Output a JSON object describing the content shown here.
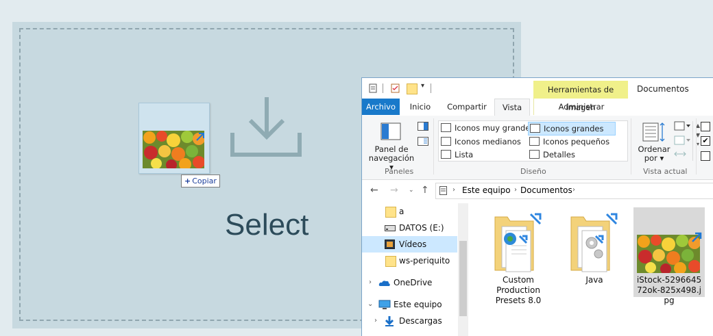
{
  "dropzone": {
    "text": "Select"
  },
  "drag": {
    "tooltip": "Copiar"
  },
  "explorer": {
    "window_title": "Documentos",
    "contextual_tab": "Herramientas de imagen",
    "tabs": [
      "Archivo",
      "Inicio",
      "Compartir",
      "Vista",
      "Administrar"
    ],
    "ribbon": {
      "panes_button": "Panel de navegación",
      "panes_group": "Paneles",
      "layouts": [
        "Iconos muy grandes",
        "Iconos grandes",
        "Iconos medianos",
        "Iconos pequeños",
        "Lista",
        "Detalles"
      ],
      "layouts_selected": "Iconos grandes",
      "layout_group": "Diseño",
      "sort_button": "Ordenar por",
      "current_view_group": "Vista actual"
    },
    "address": {
      "crumbs": [
        "Este equipo",
        "Documentos"
      ]
    },
    "nav_items": [
      {
        "label": "a",
        "icon": "folder-icon"
      },
      {
        "label": "DATOS (E:)",
        "icon": "drive-icon"
      },
      {
        "label": "Vídeos",
        "icon": "videos-icon",
        "selected": true
      },
      {
        "label": "ws-periquito",
        "icon": "folder-icon"
      },
      {
        "label": "OneDrive",
        "icon": "onedrive-icon"
      },
      {
        "label": "Este equipo",
        "icon": "computer-icon"
      },
      {
        "label": "Descargas",
        "icon": "downloads-icon"
      }
    ],
    "files": [
      {
        "label": "Custom Production Presets 8.0",
        "type": "folder-shortcut"
      },
      {
        "label": "Java",
        "type": "folder-shortcut"
      },
      {
        "label": "iStock-529664572ok-825x498.jpg",
        "type": "image",
        "selected": true
      }
    ]
  }
}
